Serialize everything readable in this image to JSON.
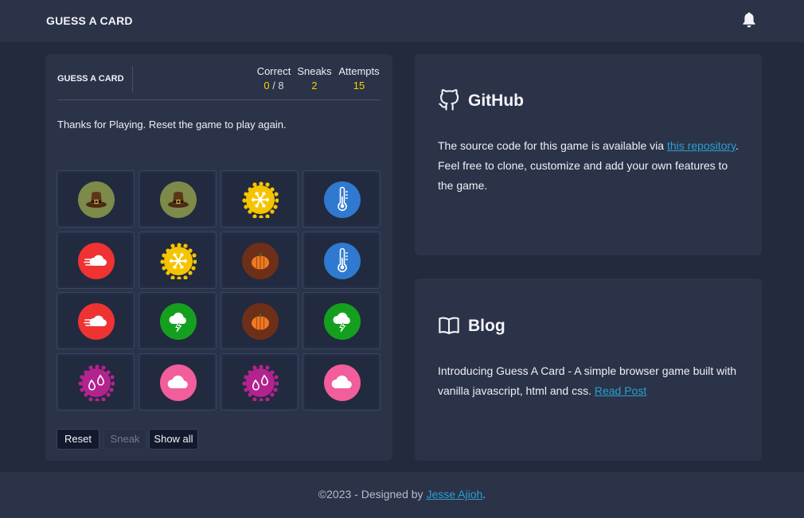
{
  "app": {
    "title": "GUESS A CARD"
  },
  "header": {
    "bell_icon": "bell-icon"
  },
  "game": {
    "title": "GUESS A CARD",
    "stats": {
      "correct_label": "Correct",
      "correct_value": "0",
      "correct_total": "8",
      "sneaks_label": "Sneaks",
      "sneaks_value": "2",
      "attempts_label": "Attempts",
      "attempts_value": "15"
    },
    "message": "Thanks for Playing. Reset the game to play again.",
    "cards": [
      {
        "icon": "pilgrim-hat-icon",
        "color": "#7d8a4a"
      },
      {
        "icon": "pilgrim-hat-icon",
        "color": "#7d8a4a"
      },
      {
        "icon": "snowflake-icon",
        "color": "#f5c400"
      },
      {
        "icon": "thermometer-icon",
        "color": "#2f7ad0"
      },
      {
        "icon": "wind-cloud-icon",
        "color": "#ef3232"
      },
      {
        "icon": "snowflake-icon",
        "color": "#f5c400"
      },
      {
        "icon": "pumpkin-icon",
        "color": "#6e2f18"
      },
      {
        "icon": "thermometer-icon",
        "color": "#2f7ad0"
      },
      {
        "icon": "wind-cloud-icon",
        "color": "#ef3232"
      },
      {
        "icon": "storm-cloud-icon",
        "color": "#14a01e"
      },
      {
        "icon": "pumpkin-icon",
        "color": "#6e2f18"
      },
      {
        "icon": "storm-cloud-icon",
        "color": "#14a01e"
      },
      {
        "icon": "raindrops-icon",
        "color": "#b3238e"
      },
      {
        "icon": "cloud-icon",
        "color": "#f25d9c"
      },
      {
        "icon": "raindrops-icon",
        "color": "#b3238e"
      },
      {
        "icon": "cloud-icon",
        "color": "#f25d9c"
      }
    ],
    "buttons": {
      "reset": "Reset",
      "sneak": "Sneak",
      "show_all": "Show all"
    }
  },
  "github": {
    "icon": "github-icon",
    "title": "GitHub",
    "text_before": "The source code for this game is available via ",
    "link_text": "this repository",
    "text_after": ". Feel free to clone, customize and add your own features to the game."
  },
  "blog": {
    "icon": "open-book-icon",
    "title": "Blog",
    "text": "Introducing Guess A Card - A simple browser game built with vanilla javascript, html and css. ",
    "link_text": "Read Post"
  },
  "footer": {
    "text": "©2023 - Designed by ",
    "link_text": "Jesse Ajioh",
    "suffix": "."
  },
  "colors": {
    "background": "#232a3d",
    "panel": "#2b3349",
    "accent_yellow": "#f6d200",
    "link": "#2b9fd0"
  }
}
